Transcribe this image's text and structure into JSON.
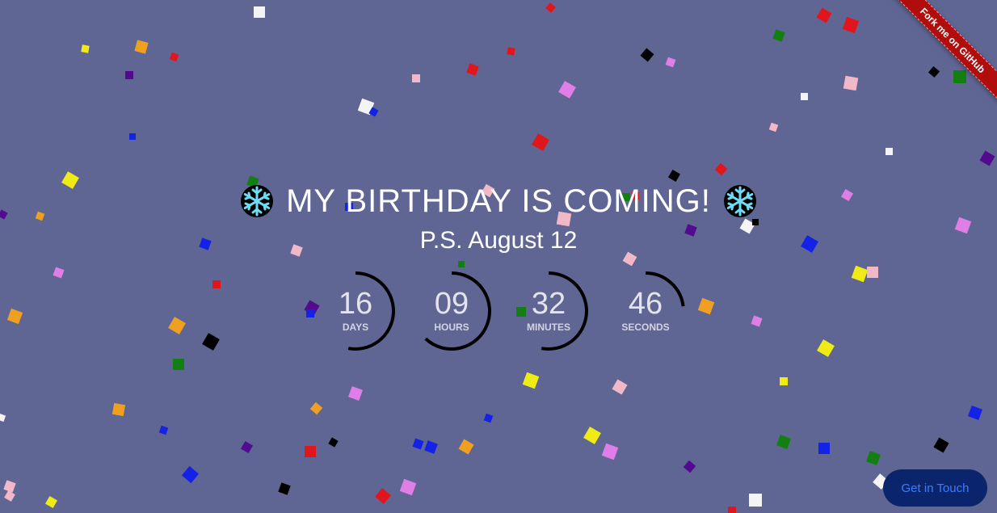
{
  "page": {
    "title": "MY BIRTHDAY IS COMING!",
    "subtitle": "P.S. August 12",
    "title_icons": [
      "snowflake-icon",
      "snowflake-icon"
    ]
  },
  "countdown": [
    {
      "value": "16",
      "label": "DAYS",
      "progress": 0.53
    },
    {
      "value": "09",
      "label": "HOURS",
      "progress": 0.62
    },
    {
      "value": "32",
      "label": "MINUTES",
      "progress": 0.53
    },
    {
      "value": "46",
      "label": "SECONDS",
      "progress": 0.23
    }
  ],
  "ribbon": {
    "label": "Fork me on GitHub"
  },
  "contact_button": {
    "label": "Get in Touch"
  },
  "colors": {
    "background": "#5f6693",
    "ring": "#000000",
    "ribbon": "#b20d0d",
    "contact_bg": "#0a256c",
    "contact_text": "#3d7bff",
    "snowflake": "#6fdcf5",
    "confetti_palette": [
      "#e1161d",
      "#f0a020",
      "#f0ea16",
      "#137f13",
      "#1421e6",
      "#520a8f",
      "#e07ee8",
      "#f1b8c8",
      "#000000",
      "#f4f4f4"
    ]
  }
}
